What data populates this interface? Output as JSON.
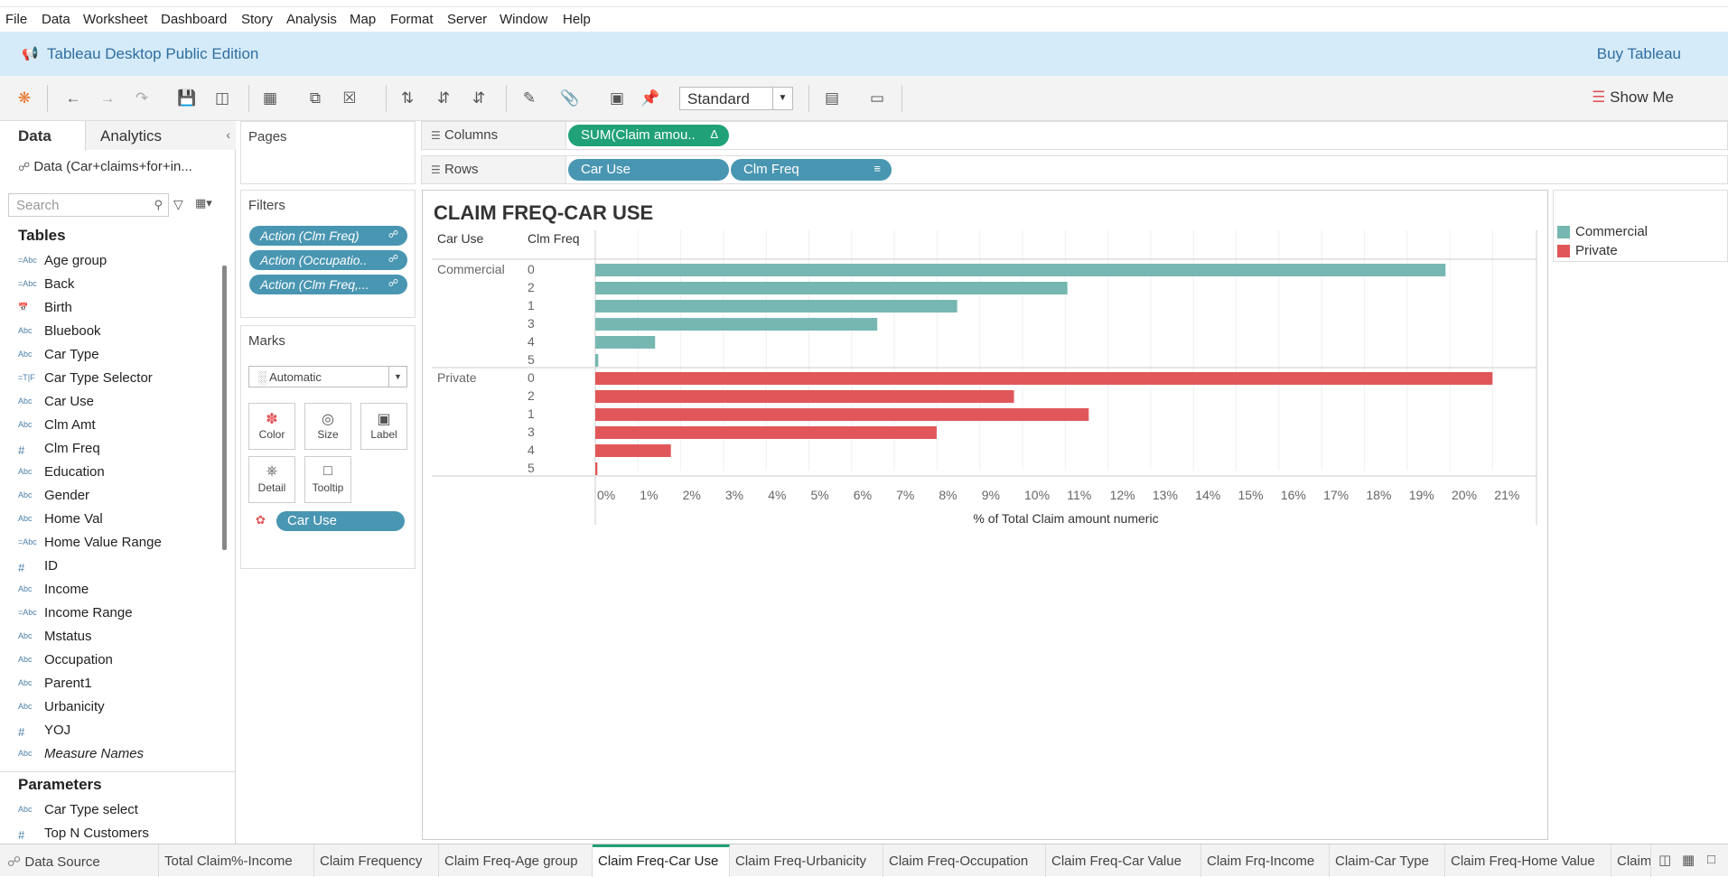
{
  "menu": [
    "File",
    "Data",
    "Worksheet",
    "Dashboard",
    "Story",
    "Analysis",
    "Map",
    "Format",
    "Server",
    "Window",
    "Help"
  ],
  "banner": {
    "title": "Tableau Desktop Public Edition",
    "buy": "Buy Tableau"
  },
  "toolbar": {
    "fit": "Standard",
    "show_me": "Show Me"
  },
  "left": {
    "tab_data": "Data",
    "tab_analytics": "Analytics",
    "datasource": "Data (Car+claims+for+in...",
    "search_placeholder": "Search",
    "tables_header": "Tables",
    "fields": [
      {
        "icon": "=Abc",
        "label": "Age group"
      },
      {
        "icon": "=Abc",
        "label": "Back"
      },
      {
        "icon": "date",
        "label": "Birth"
      },
      {
        "icon": "Abc",
        "label": "Bluebook"
      },
      {
        "icon": "Abc",
        "label": "Car Type"
      },
      {
        "icon": "=T|F",
        "label": "Car Type Selector"
      },
      {
        "icon": "Abc",
        "label": "Car Use"
      },
      {
        "icon": "Abc",
        "label": "Clm Amt"
      },
      {
        "icon": "#",
        "label": "Clm Freq"
      },
      {
        "icon": "Abc",
        "label": "Education"
      },
      {
        "icon": "Abc",
        "label": "Gender"
      },
      {
        "icon": "Abc",
        "label": "Home Val"
      },
      {
        "icon": "=Abc",
        "label": "Home Value Range"
      },
      {
        "icon": "#",
        "label": "ID"
      },
      {
        "icon": "Abc",
        "label": "Income"
      },
      {
        "icon": "=Abc",
        "label": "Income Range"
      },
      {
        "icon": "Abc",
        "label": "Mstatus"
      },
      {
        "icon": "Abc",
        "label": "Occupation"
      },
      {
        "icon": "Abc",
        "label": "Parent1"
      },
      {
        "icon": "Abc",
        "label": "Urbanicity"
      },
      {
        "icon": "#",
        "label": "YOJ"
      },
      {
        "icon": "Abc",
        "label": "Measure Names"
      }
    ],
    "params_header": "Parameters",
    "params": [
      {
        "icon": "Abc",
        "label": "Car Type select"
      },
      {
        "icon": "#",
        "label": "Top N Customers"
      }
    ]
  },
  "pages": {
    "label": "Pages"
  },
  "filters": {
    "label": "Filters",
    "items": [
      "Action (Clm Freq)",
      "Action (Occupatio..",
      "Action (Clm Freq,..."
    ]
  },
  "marks": {
    "label": "Marks",
    "type": "Automatic",
    "buttons": [
      "Color",
      "Size",
      "Label",
      "Detail",
      "Tooltip"
    ],
    "color_field": "Car Use"
  },
  "shelves": {
    "columns_label": "Columns",
    "columns_pill": "SUM(Claim amou..",
    "rows_label": "Rows",
    "rows_pills": [
      "Car Use",
      "Clm Freq"
    ]
  },
  "legend": [
    {
      "label": "Commercial",
      "color": "#76b7b2"
    },
    {
      "label": "Private",
      "color": "#e15759"
    }
  ],
  "chart_data": {
    "type": "bar",
    "orientation": "horizontal",
    "title": "CLAIM FREQ-CAR USE",
    "row_headers": [
      "Car Use",
      "Clm Freq"
    ],
    "xlabel": "% of Total Claim amount numeric",
    "xlim": [
      0,
      22
    ],
    "x_ticks": [
      "0%",
      "1%",
      "2%",
      "3%",
      "4%",
      "5%",
      "6%",
      "7%",
      "8%",
      "9%",
      "10%",
      "11%",
      "12%",
      "13%",
      "14%",
      "15%",
      "16%",
      "17%",
      "18%",
      "19%",
      "20%",
      "21%"
    ],
    "groups": [
      {
        "name": "Commercial",
        "color": "#76b7b2",
        "categories": [
          "0",
          "2",
          "1",
          "3",
          "4",
          "5"
        ],
        "values": [
          19.9,
          11.05,
          8.47,
          6.6,
          1.4,
          0.07
        ]
      },
      {
        "name": "Private",
        "color": "#e15759",
        "categories": [
          "0",
          "2",
          "1",
          "3",
          "4",
          "5"
        ],
        "values": [
          21.0,
          9.8,
          11.55,
          7.99,
          1.77,
          0.05
        ]
      }
    ]
  },
  "bottom_tabs": [
    "Data Source",
    "Total Claim%-Income",
    "Claim Frequency",
    "Claim Freq-Age group",
    "Claim Freq-Car Use",
    "Claim Freq-Urbanicity",
    "Claim Freq-Occupation",
    "Claim Freq-Car Value",
    "Claim Frq-Income",
    "Claim-Car Type",
    "Claim Freq-Home Value",
    "Claim"
  ],
  "active_tab": "Claim Freq-Car Use"
}
